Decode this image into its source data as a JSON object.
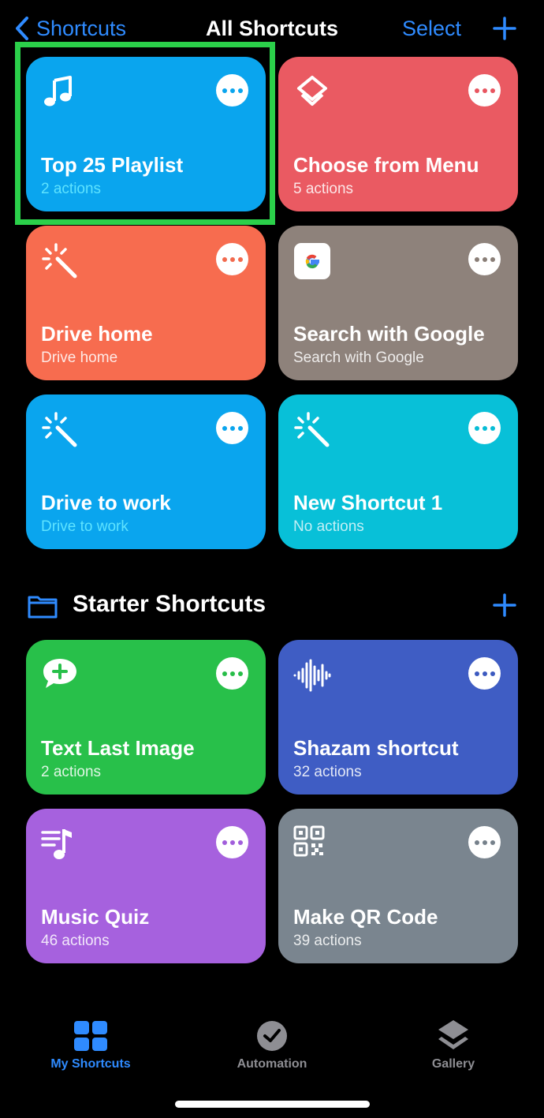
{
  "nav": {
    "back_label": "Shortcuts",
    "title": "All Shortcuts",
    "select_label": "Select"
  },
  "shortcuts": [
    {
      "title": "Top 25 Playlist",
      "subtitle": "2 actions",
      "icon": "music-note-icon",
      "color": "#0aa5ee",
      "dot_color": "#0aa5ee"
    },
    {
      "title": "Choose from Menu",
      "subtitle": "5 actions",
      "icon": "layers-icon",
      "color": "#ea5a62",
      "dot_color": "#e85560"
    },
    {
      "title": "Drive home",
      "subtitle": "Drive home",
      "icon": "magic-wand-icon",
      "color": "#f76c4f",
      "dot_color": "#f26a4e"
    },
    {
      "title": "Search with Google",
      "subtitle": "Search with Google",
      "icon": "google-icon",
      "color": "#8e827b",
      "dot_color": "#8a7e77"
    },
    {
      "title": "Drive to work",
      "subtitle": "Drive to work",
      "icon": "magic-wand-icon",
      "color": "#0aa5ee",
      "dot_color": "#0aa5ee"
    },
    {
      "title": "New Shortcut 1",
      "subtitle": "No actions",
      "icon": "magic-wand-icon",
      "color": "#08c0d8",
      "dot_color": "#07bdd6"
    }
  ],
  "folder": {
    "title": "Starter Shortcuts"
  },
  "starter_shortcuts": [
    {
      "title": "Text Last Image",
      "subtitle": "2 actions",
      "icon": "message-plus-icon",
      "color": "#28c04a",
      "dot_color": "#27bd48"
    },
    {
      "title": "Shazam shortcut",
      "subtitle": "32 actions",
      "icon": "waveform-icon",
      "color": "#3f5dc4",
      "dot_color": "#3c5ac0"
    },
    {
      "title": "Music Quiz",
      "subtitle": "46 actions",
      "icon": "music-list-icon",
      "color": "#a661de",
      "dot_color": "#a15edb"
    },
    {
      "title": "Make QR Code",
      "subtitle": "39 actions",
      "icon": "qr-code-icon",
      "color": "#7a858f",
      "dot_color": "#76818b"
    }
  ],
  "tabs": [
    {
      "label": "My Shortcuts",
      "icon": "grid-icon",
      "active": true
    },
    {
      "label": "Automation",
      "icon": "clock-check-icon",
      "active": false
    },
    {
      "label": "Gallery",
      "icon": "layers-icon",
      "active": false
    }
  ],
  "colors": {
    "accent": "#2f8bff",
    "highlight": "#2bd04a",
    "tab_inactive": "#8e8e93"
  }
}
